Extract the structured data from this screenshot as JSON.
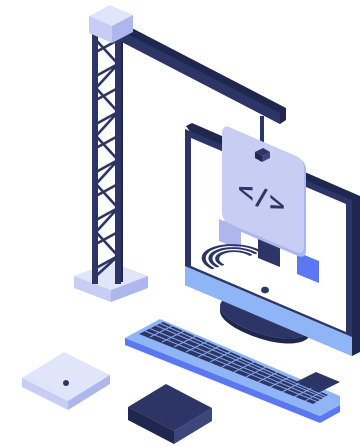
{
  "illustration": {
    "code_glyph": "</>",
    "colors": {
      "navy": "#2C3566",
      "navy_dark": "#1F2750",
      "navy_light": "#3C467A",
      "lavender": "#C7CDF3",
      "lavender_light": "#E1E5FA",
      "lavender_mid": "#AEB6EE",
      "blue": "#5B77F1",
      "sky": "#8FB5F6",
      "white": "#FFFFFF"
    },
    "icons": [
      "tower-crane-icon",
      "computer-monitor-icon",
      "code-window-icon",
      "keyboard-icon",
      "wifi-router-icon",
      "mini-pc-icon"
    ]
  }
}
